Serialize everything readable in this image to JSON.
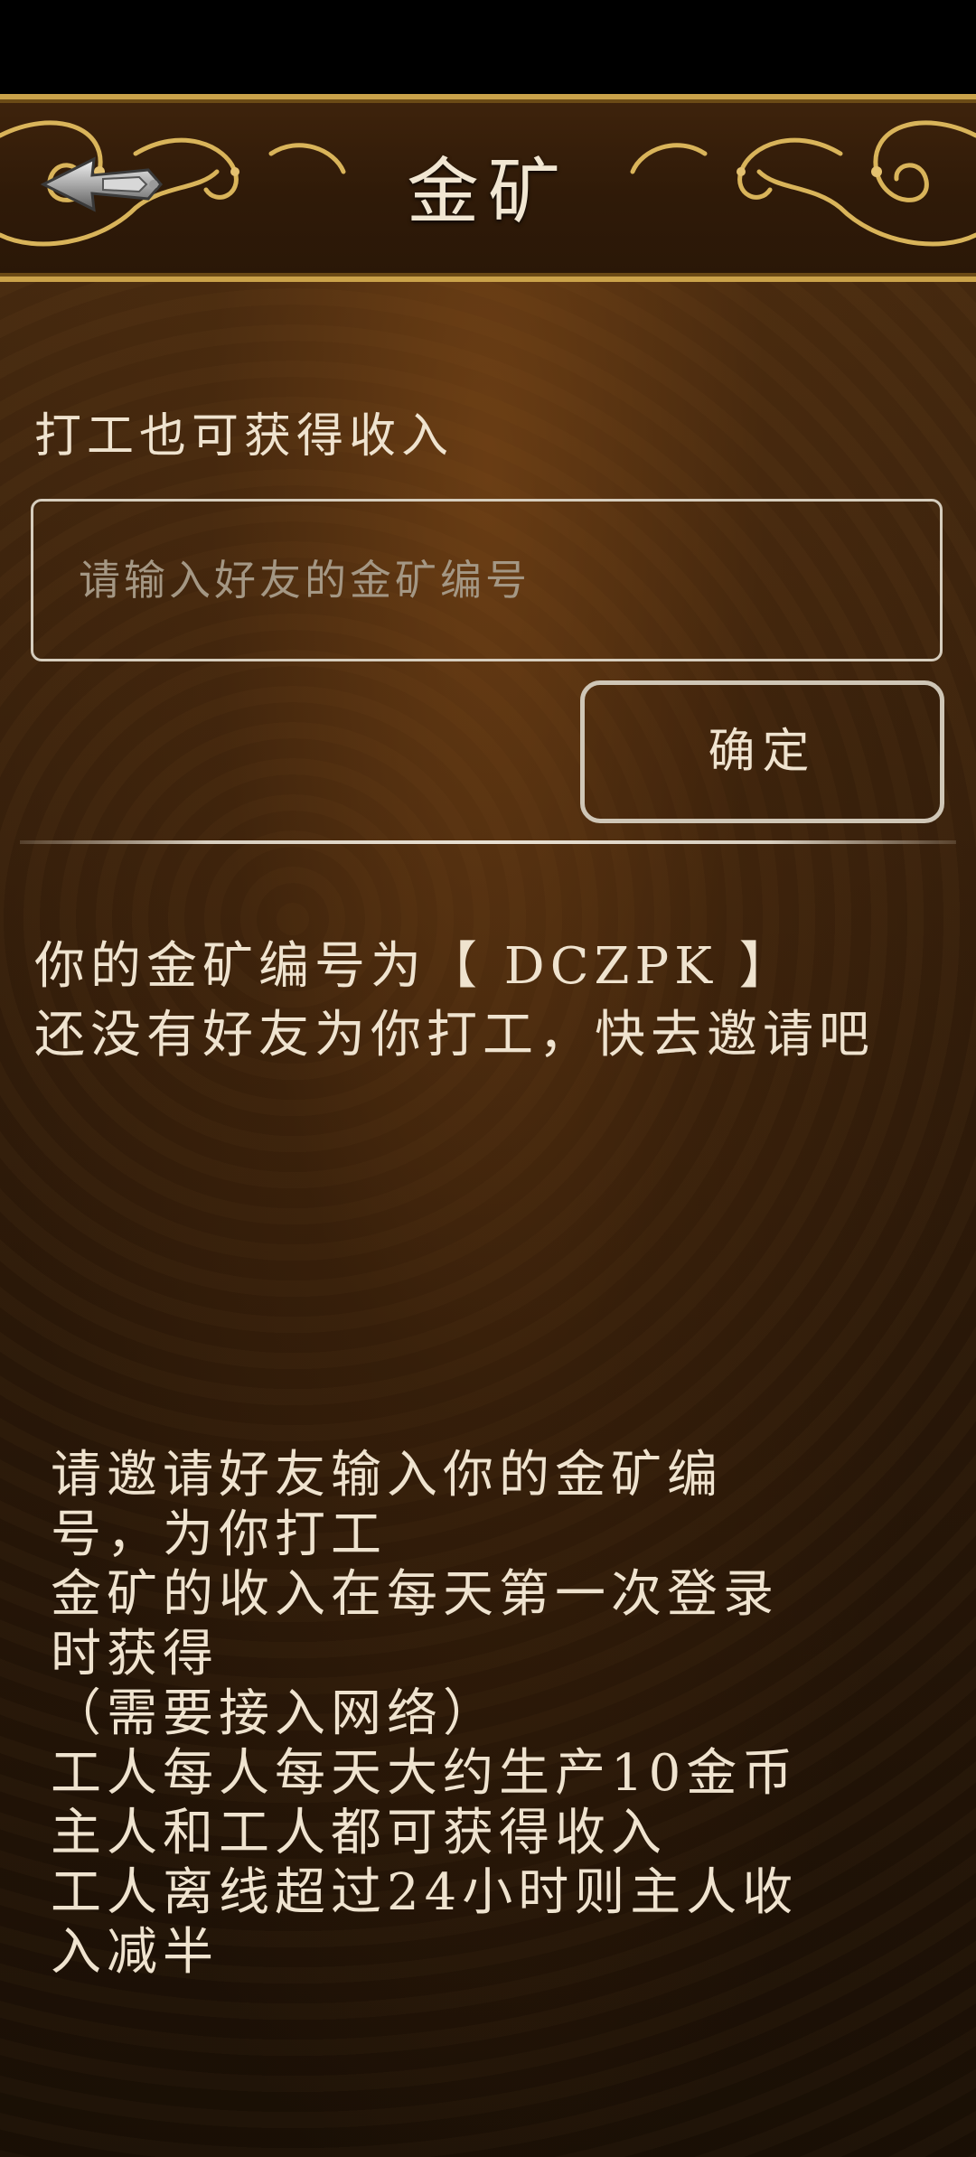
{
  "header": {
    "title": "金矿",
    "back_icon": "winged-arrow-back-icon"
  },
  "invite": {
    "label": "打工也可获得收入",
    "input_placeholder": "请输入好友的金矿编号",
    "input_value": "",
    "confirm_label": "确定"
  },
  "status": {
    "code_line": "你的金矿编号为【 DCZPK 】",
    "no_friends_message": "还没有好友为你打工，快去邀请吧"
  },
  "instructions": [
    "请邀请好友输入你的金矿编",
    "号，为你打工",
    "金矿的收入在每天第一次登录",
    "时获得",
    "（需要接入网络）",
    "工人每人每天大约生产10金币",
    "主人和工人都可获得收入",
    "工人离线超过24小时则主人收",
    "入减半"
  ],
  "colors": {
    "text": "#efe3cf",
    "gold_trim": "#caa24a",
    "background_top": "#4a2c10",
    "background_bottom": "#1a0f05"
  }
}
